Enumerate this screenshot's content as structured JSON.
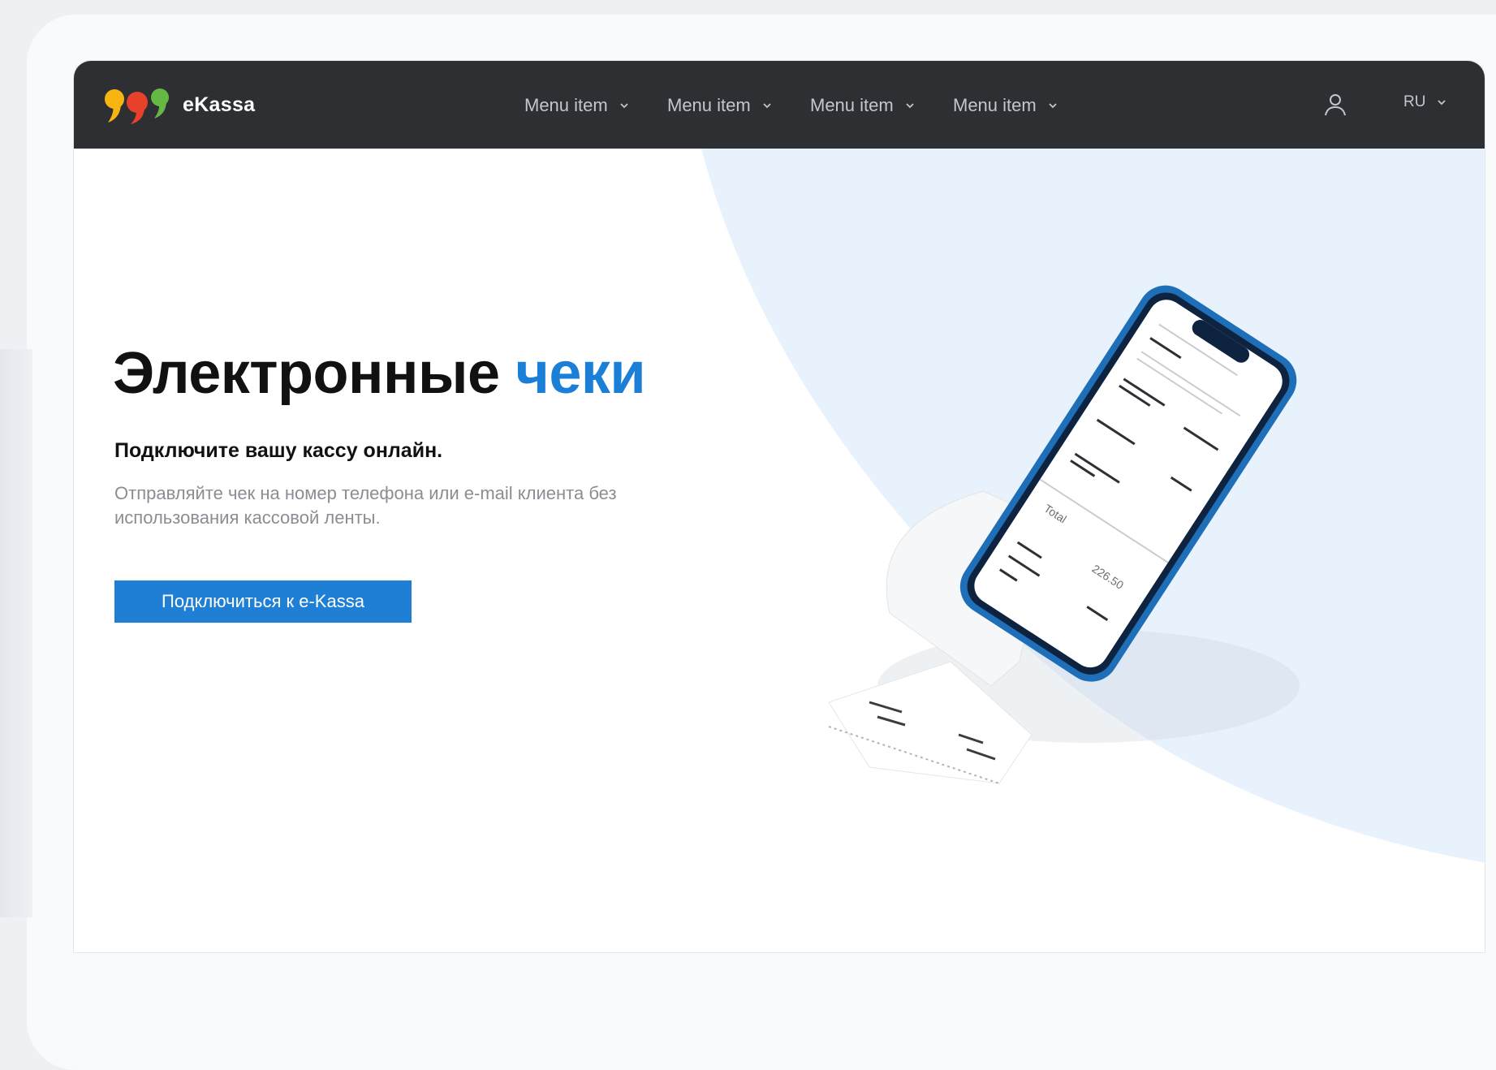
{
  "header": {
    "brand": "eKassa",
    "menu": [
      {
        "label": "Menu item"
      },
      {
        "label": "Menu item"
      },
      {
        "label": "Menu item"
      },
      {
        "label": "Menu item"
      }
    ],
    "language": "RU",
    "icons": {
      "user": "user-icon",
      "chevron": "chevron-down-icon"
    }
  },
  "hero": {
    "title_main": "Электронные",
    "title_accent": "чеки",
    "subtitle": "Подключите вашу кассу онлайн.",
    "description": "Отправляйте чек на номер телефона или e-mail клиента без использования кассовой ленты.",
    "cta_label": "Подключиться к e-Kassa",
    "receipt": {
      "total_label": "Total",
      "total_value": "226.50"
    }
  },
  "colors": {
    "navbar": "#2e2f33",
    "accent": "#1b7fd8",
    "button": "#1f7fd4",
    "hero_shape": "#e8f2fd",
    "logo_yellow": "#f7b511",
    "logo_red": "#e8412b",
    "logo_green": "#66b845"
  }
}
